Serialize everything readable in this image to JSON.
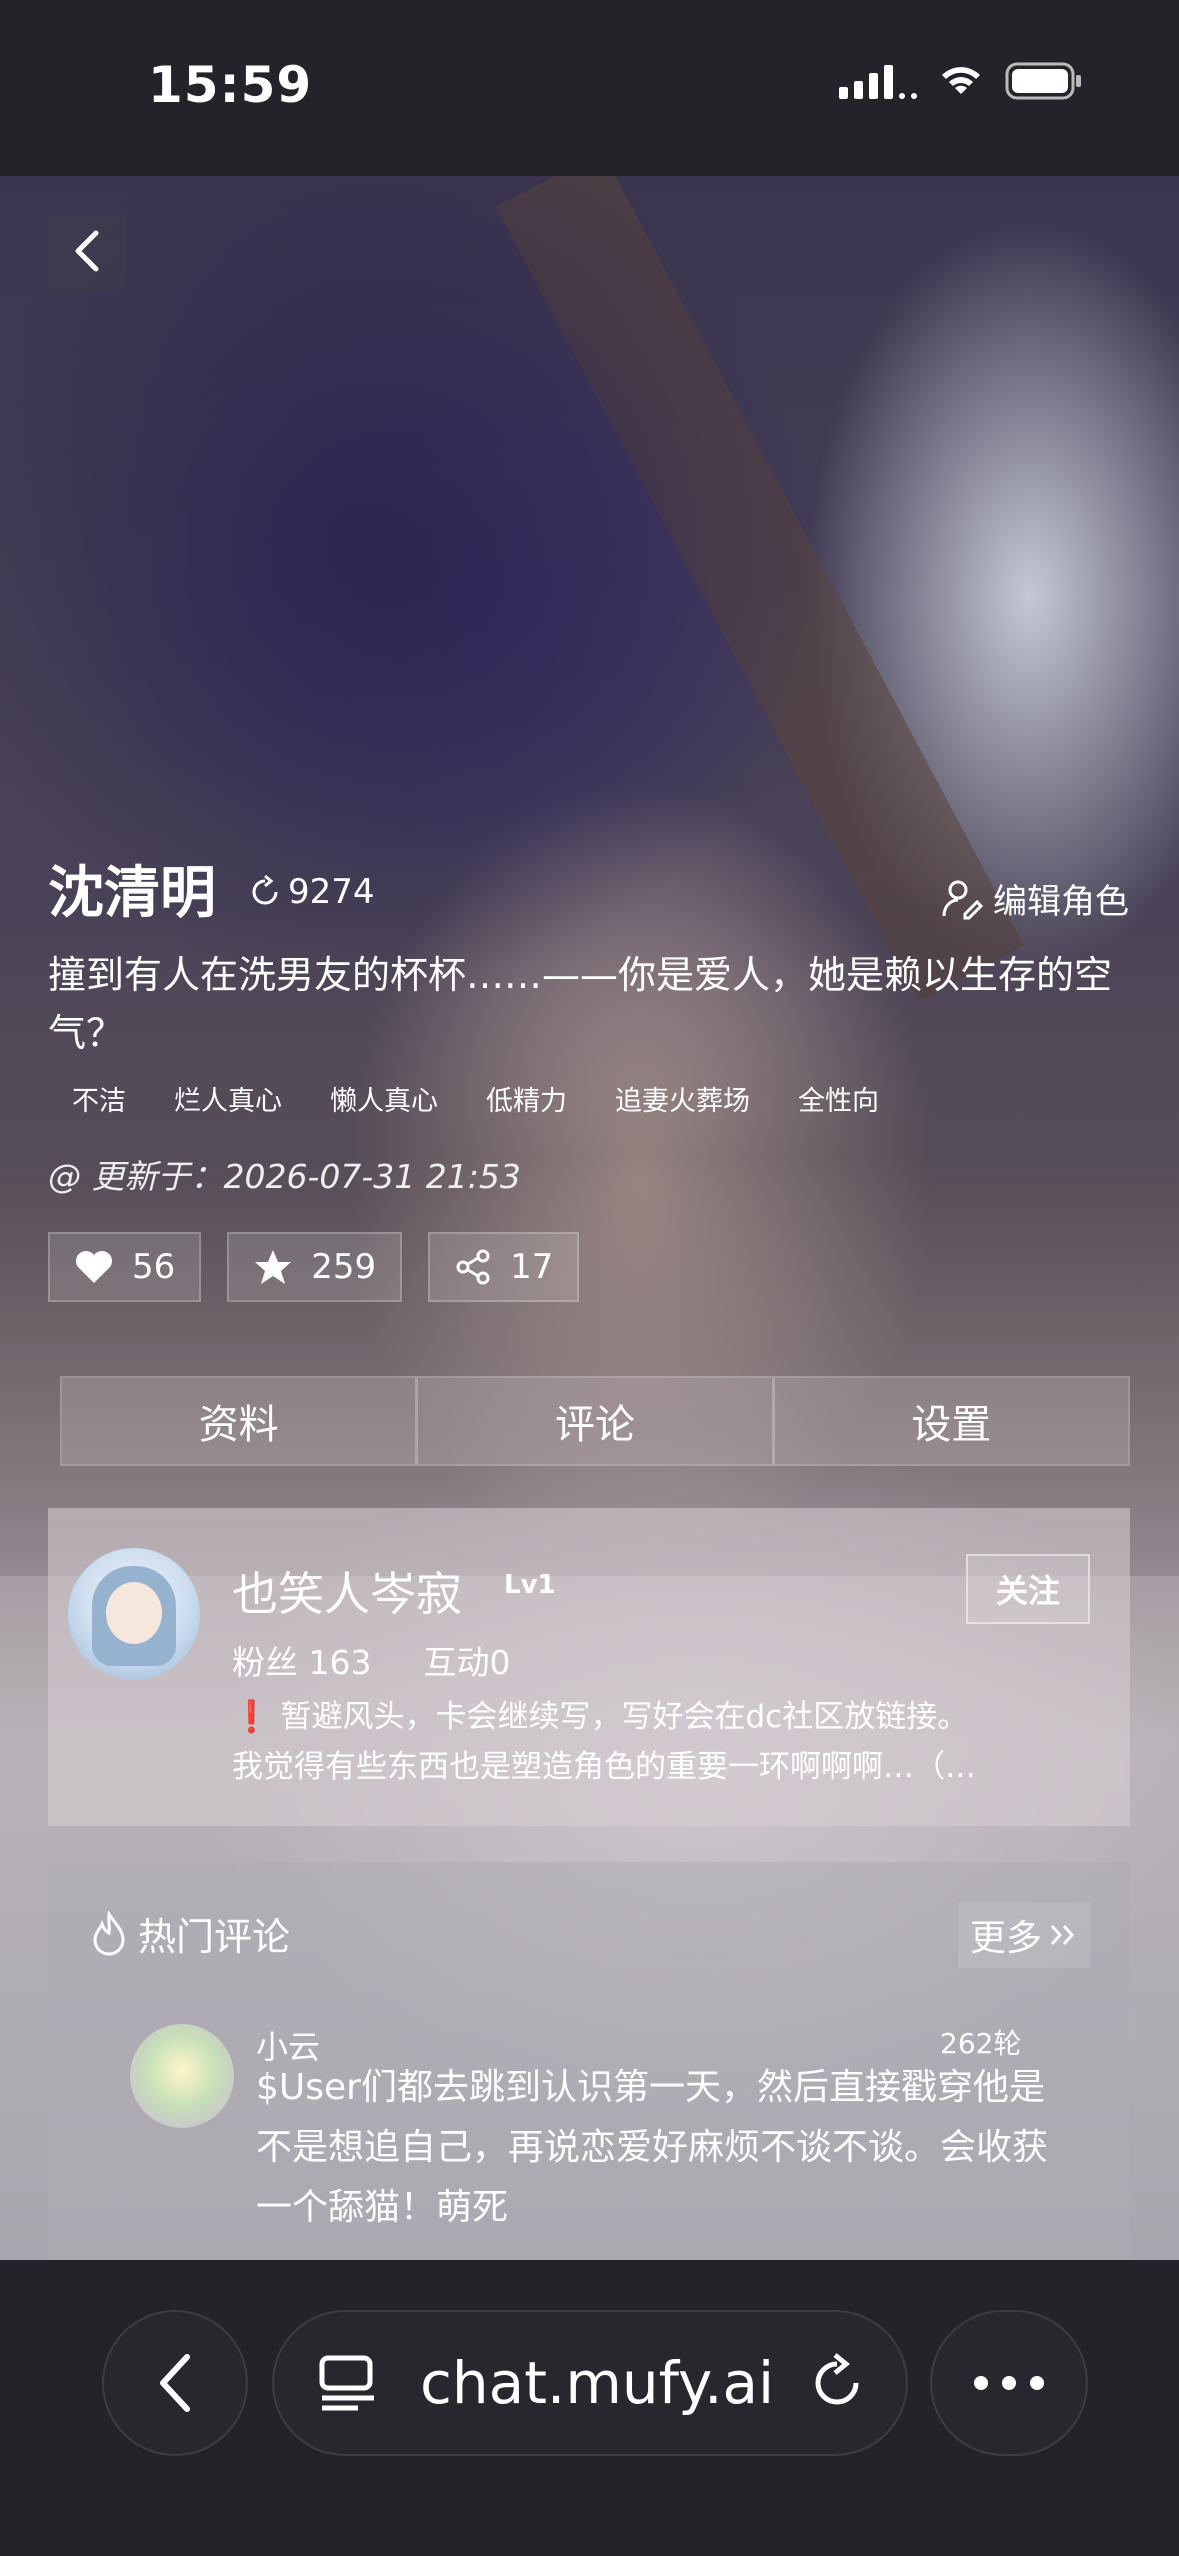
{
  "status_bar": {
    "time": "15:59"
  },
  "character": {
    "name": "沈清明",
    "hot_count": "9274",
    "edit_label": "编辑角色",
    "description": "撞到有人在洗男友的杯杯……——你是爱人，她是赖以生存的空气？",
    "tags": [
      "不洁",
      "烂人真心",
      "懒人真心",
      "低精力",
      "追妻火葬场",
      "全性向"
    ],
    "updated": "@ 更新于：2026-07-31 21:53",
    "likes": "56",
    "favorites": "259",
    "shares": "17"
  },
  "tabs": [
    "资料",
    "评论",
    "设置"
  ],
  "author": {
    "name": "也笑人岑寂",
    "level": "Lv1",
    "follow_label": "关注",
    "fans_label": "粉丝 163",
    "interaction_label": "互动0",
    "bio_mark": "❗",
    "bio_line1": "暂避风头，卡会继续写，写好会在dc社区放链接。",
    "bio_line2": "我觉得有些东西也是塑造角色的重要一环啊啊啊…（…"
  },
  "comments": {
    "title": "热门评论",
    "more_label": "更多",
    "items": [
      {
        "user": "小云",
        "rounds": "262轮",
        "text": "$User们都去跳到认识第一天，然后直接戳穿他是不是想追自己，再说恋爱好麻烦不谈不谈。会收获一个舔猫！萌死"
      }
    ]
  },
  "browser": {
    "url": "chat.mufy.ai"
  }
}
